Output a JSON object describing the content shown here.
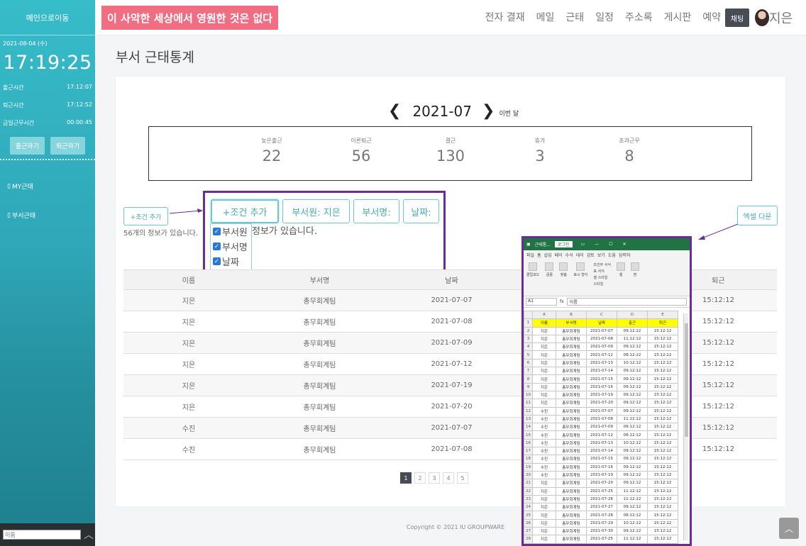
{
  "sidebar": {
    "home_label": "메인으로이동",
    "date": "2021-08-04 (수)",
    "clock": "17:19:25",
    "rows": [
      {
        "label": "출근시간",
        "value": "17:12:07"
      },
      {
        "label": "퇴근시간",
        "value": "17:12:52"
      },
      {
        "label": "금일근무시간",
        "value": "00:00:45"
      }
    ],
    "checkin_label": "출근하기",
    "checkout_label": "퇴근하기",
    "menu": [
      "MY근태",
      "부서근태"
    ],
    "search_placeholder": "이름"
  },
  "topbar": {
    "banner": "이 사악한 세상에서 영원한 것은 없다",
    "nav": [
      "전자 결재",
      "메일",
      "근태",
      "일정",
      "주소록",
      "게시판",
      "예약"
    ],
    "chat_label": "채팅",
    "user_name": "지은"
  },
  "page": {
    "title": "부서 근태통계",
    "month": "2021-07",
    "this_month": "이번 달",
    "stats": [
      {
        "label": "늦은출근",
        "value": "22"
      },
      {
        "label": "이른퇴근",
        "value": "56"
      },
      {
        "label": "결근",
        "value": "130"
      },
      {
        "label": "휴가",
        "value": "3"
      },
      {
        "label": "초과근무",
        "value": "8"
      }
    ],
    "add_condition_small": "+조건 추가",
    "count_text": "56개의 정보가 있습니다.",
    "filters": [
      "+조건 추가",
      "부서원: 지은",
      "부서명:",
      "날짜:"
    ],
    "checklist": [
      "부서원",
      "부서명",
      "날짜"
    ],
    "check_note": "정보가 있습니다.",
    "excel_label": "엑셀 다운",
    "table": {
      "headers": [
        "이름",
        "부서명",
        "날짜",
        "",
        "퇴근"
      ],
      "rows": [
        [
          "지은",
          "총무회계팀",
          "2021-07-07",
          "15:12:12"
        ],
        [
          "지은",
          "총무회계팀",
          "2021-07-08",
          "15:12:12"
        ],
        [
          "지은",
          "총무회계팀",
          "2021-07-09",
          "15:12:12"
        ],
        [
          "지은",
          "총무회계팀",
          "2021-07-12",
          "15:12:12"
        ],
        [
          "지은",
          "총무회계팀",
          "2021-07-19",
          "15:12:12"
        ],
        [
          "지은",
          "총무회계팀",
          "2021-07-20",
          "15:12:12"
        ],
        [
          "수진",
          "총무회계팀",
          "2021-07-07",
          "15:12:12"
        ],
        [
          "수진",
          "총무회계팀",
          "2021-07-08",
          "15:12:12"
        ]
      ]
    },
    "pages": [
      "1",
      "2",
      "3",
      "4",
      "5"
    ],
    "footer": "Copyright © 2021 IU GROUPWARE"
  },
  "excel": {
    "title": "근태통...",
    "login": "로그인",
    "tabs": [
      "파일",
      "홈",
      "삽입",
      "페이",
      "수식",
      "데이",
      "검토",
      "보기",
      "도움",
      "입력하"
    ],
    "groups": [
      "클립보드",
      "글꼴",
      "맞춤",
      "표시 형식",
      "조건부 서식",
      "표 서식",
      "셀 스타일",
      "셀",
      "편"
    ],
    "style_label": "스타일",
    "cell_ref": "A1",
    "formula": "이름",
    "columns": [
      "",
      "A",
      "B",
      "C",
      "D",
      "E"
    ],
    "header_row": [
      "이름",
      "부서명",
      "날짜",
      "출근",
      "퇴근"
    ],
    "rows": [
      [
        "지은",
        "총무회계팀",
        "2021-07-07",
        "09:12:12",
        "15:12:12"
      ],
      [
        "지은",
        "총무회계팀",
        "2021-07-08",
        "11:12:12",
        "15:12:12"
      ],
      [
        "지은",
        "총무회계팀",
        "2021-07-09",
        "09:12:12",
        "15:12:12"
      ],
      [
        "지은",
        "총무회계팀",
        "2021-07-12",
        "08:12:12",
        "15:12:12"
      ],
      [
        "지은",
        "총무회계팀",
        "2021-07-13",
        "10:12:12",
        "15:12:12"
      ],
      [
        "지은",
        "총무회계팀",
        "2021-07-14",
        "09:12:12",
        "15:12:12"
      ],
      [
        "지은",
        "총무회계팀",
        "2021-07-15",
        "09:12:12",
        "15:12:12"
      ],
      [
        "지은",
        "총무회계팀",
        "2021-07-16",
        "09:12:12",
        "15:12:12"
      ],
      [
        "지은",
        "총무회계팀",
        "2021-07-19",
        "09:12:12",
        "15:12:12"
      ],
      [
        "지은",
        "총무회계팀",
        "2021-07-20",
        "09:12:12",
        "15:12:12"
      ],
      [
        "수진",
        "총무회계팀",
        "2021-07-07",
        "09:12:12",
        "15:12:12"
      ],
      [
        "수진",
        "총무회계팀",
        "2021-07-08",
        "11:12:12",
        "15:12:12"
      ],
      [
        "수진",
        "총무회계팀",
        "2021-07-09",
        "09:12:12",
        "15:12:12"
      ],
      [
        "수진",
        "총무회계팀",
        "2021-07-12",
        "08:12:12",
        "15:12:12"
      ],
      [
        "수진",
        "총무회계팀",
        "2021-07-13",
        "10:12:12",
        "15:12:12"
      ],
      [
        "수진",
        "총무회계팀",
        "2021-07-14",
        "09:12:12",
        "15:12:12"
      ],
      [
        "수진",
        "총무회계팀",
        "2021-07-15",
        "09:12:12",
        "15:12:12"
      ],
      [
        "수진",
        "총무회계팀",
        "2021-07-16",
        "09:12:12",
        "15:12:12"
      ],
      [
        "수진",
        "총무회계팀",
        "2021-07-19",
        "09:12:12",
        "15:12:12"
      ],
      [
        "지은",
        "총무회계팀",
        "2021-07-20",
        "09:12:12",
        "15:12:12"
      ],
      [
        "지은",
        "총무회계팀",
        "2021-07-25",
        "11:12:12",
        "15:12:12"
      ],
      [
        "지은",
        "총무회계팀",
        "2021-07-26",
        "11:12:12",
        "15:12:12"
      ],
      [
        "지은",
        "총무회계팀",
        "2021-07-27",
        "09:12:12",
        "15:12:12"
      ],
      [
        "지은",
        "총무회계팀",
        "2021-07-28",
        "08:12:12",
        "15:12:12"
      ],
      [
        "지은",
        "총무회계팀",
        "2021-07-29",
        "10:12:12",
        "15:12:12"
      ],
      [
        "지은",
        "총무회계팀",
        "2021-07-30",
        "09:12:12",
        "15:12:12"
      ],
      [
        "지은",
        "총무회계팀",
        "2021-07-25",
        "11:12:12",
        "15:12:12"
      ]
    ]
  }
}
